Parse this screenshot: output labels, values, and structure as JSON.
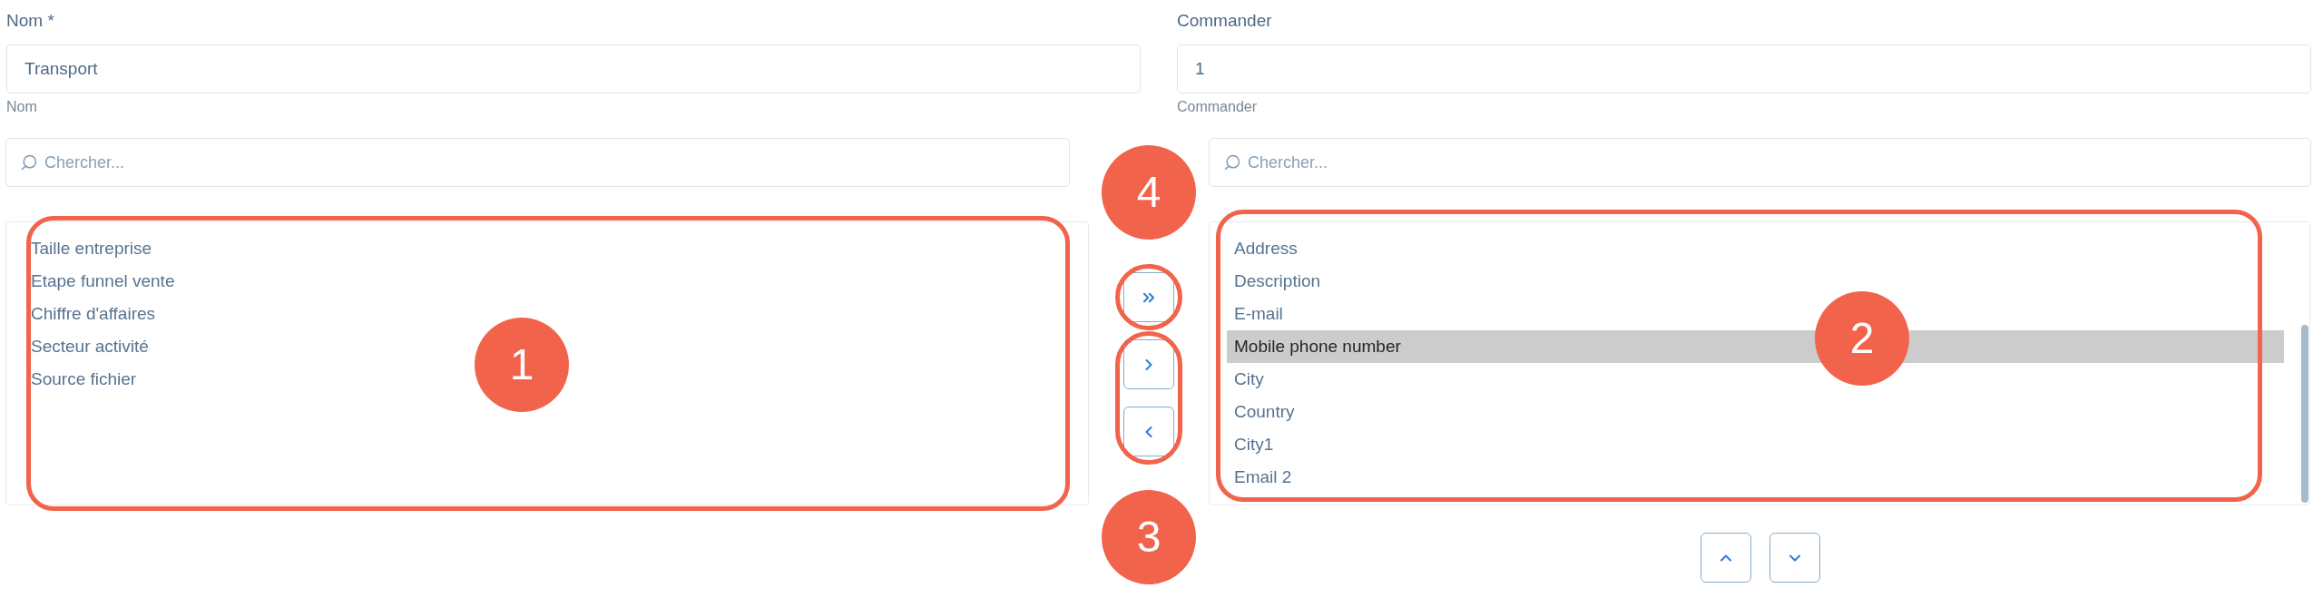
{
  "fields": [
    {
      "label": "Nom *",
      "value": "Transport",
      "helper": "Nom"
    },
    {
      "label": "Commander",
      "value": "1",
      "helper": "Commander"
    }
  ],
  "available": {
    "search": {
      "placeholder": "Chercher..."
    },
    "annotation": "1",
    "items": [
      {
        "label": "Taille entreprise",
        "selected": false
      },
      {
        "label": "Etape funnel vente",
        "selected": false
      },
      {
        "label": "Chiffre d'affaires",
        "selected": false
      },
      {
        "label": "Secteur activité",
        "selected": false
      },
      {
        "label": "Source fichier",
        "selected": false
      }
    ]
  },
  "transfer": [
    {
      "annotation": "4",
      "buttons": [
        {
          "kind": "all_right"
        }
      ]
    },
    {
      "annotation": "3",
      "buttons": [
        {
          "kind": "right"
        },
        {
          "kind": "left"
        }
      ]
    }
  ],
  "chosen": {
    "search": {
      "placeholder": "Chercher..."
    },
    "annotation": "2",
    "items": [
      {
        "label": "Address",
        "selected": false
      },
      {
        "label": "Description",
        "selected": false
      },
      {
        "label": "E-mail",
        "selected": false
      },
      {
        "label": "Mobile phone number",
        "selected": true
      },
      {
        "label": "City",
        "selected": false
      },
      {
        "label": "Country",
        "selected": false
      },
      {
        "label": "City1",
        "selected": false
      },
      {
        "label": "Email 2",
        "selected": false
      }
    ],
    "order_buttons": [
      {
        "kind": "up"
      },
      {
        "kind": "down"
      }
    ]
  }
}
